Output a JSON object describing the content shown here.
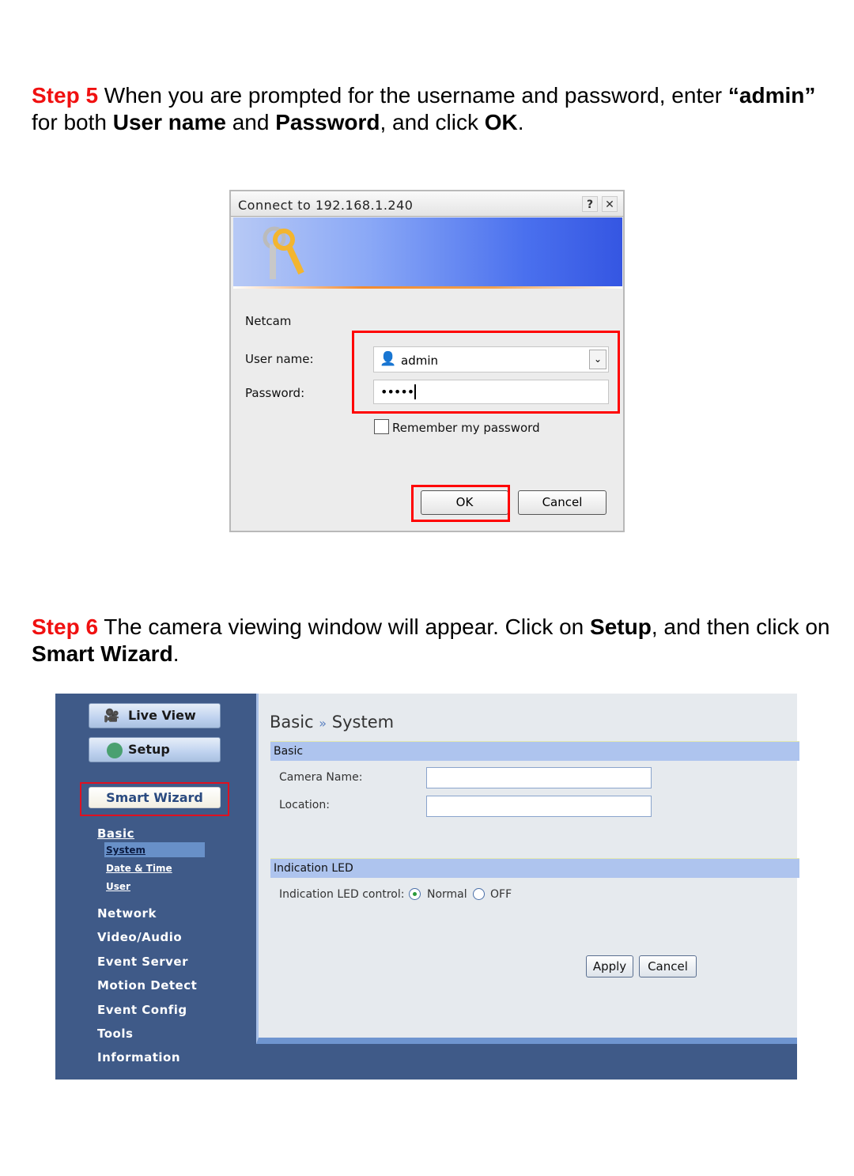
{
  "step5": {
    "label": "Step 5",
    "text_1": " When you are prompted for the username and password, enter ",
    "admin": "“admin”",
    "text_2": " for both ",
    "user_name": "User name",
    "text_3": " and ",
    "password": "Password",
    "text_4": ", and click ",
    "ok": "OK",
    "text_5": "."
  },
  "dialog": {
    "title": "Connect to 192.168.1.240",
    "help_label": "?",
    "close_label": "✕",
    "realm": "Netcam",
    "username_label": "User name:",
    "username_value": "admin",
    "password_label": "Password:",
    "password_value": "•••••",
    "remember_label": "Remember my password",
    "remember_checked": false,
    "ok_label": "OK",
    "cancel_label": "Cancel",
    "highlight_color": "#ff0000"
  },
  "step6": {
    "label": "Step 6",
    "text_1": " The camera viewing window will appear.  Click on ",
    "setup": "Setup",
    "text_2": ", and then click on ",
    "wizard": "Smart Wizard",
    "text_3": "."
  },
  "webui": {
    "live_view": "Live View",
    "setup": "Setup",
    "smart_wizard": "Smart Wizard",
    "nav_basic": "Basic",
    "sub_items": [
      "System",
      "Date & Time",
      "User"
    ],
    "nav_items": [
      "Network",
      "Video/Audio",
      "Event Server",
      "Motion Detect",
      "Event Config",
      "Tools",
      "Information"
    ],
    "page_title_1": "Basic",
    "page_title_sep": "»",
    "page_title_2": "System",
    "section_basic": "Basic",
    "camera_name_label": "Camera Name:",
    "camera_name_value": "",
    "location_label": "Location:",
    "location_value": "",
    "section_led": "Indication LED",
    "led_control_label": "Indication LED control:",
    "led_options": [
      "Normal",
      "OFF"
    ],
    "led_selected": "Normal",
    "apply_label": "Apply",
    "cancel_label": "Cancel"
  }
}
